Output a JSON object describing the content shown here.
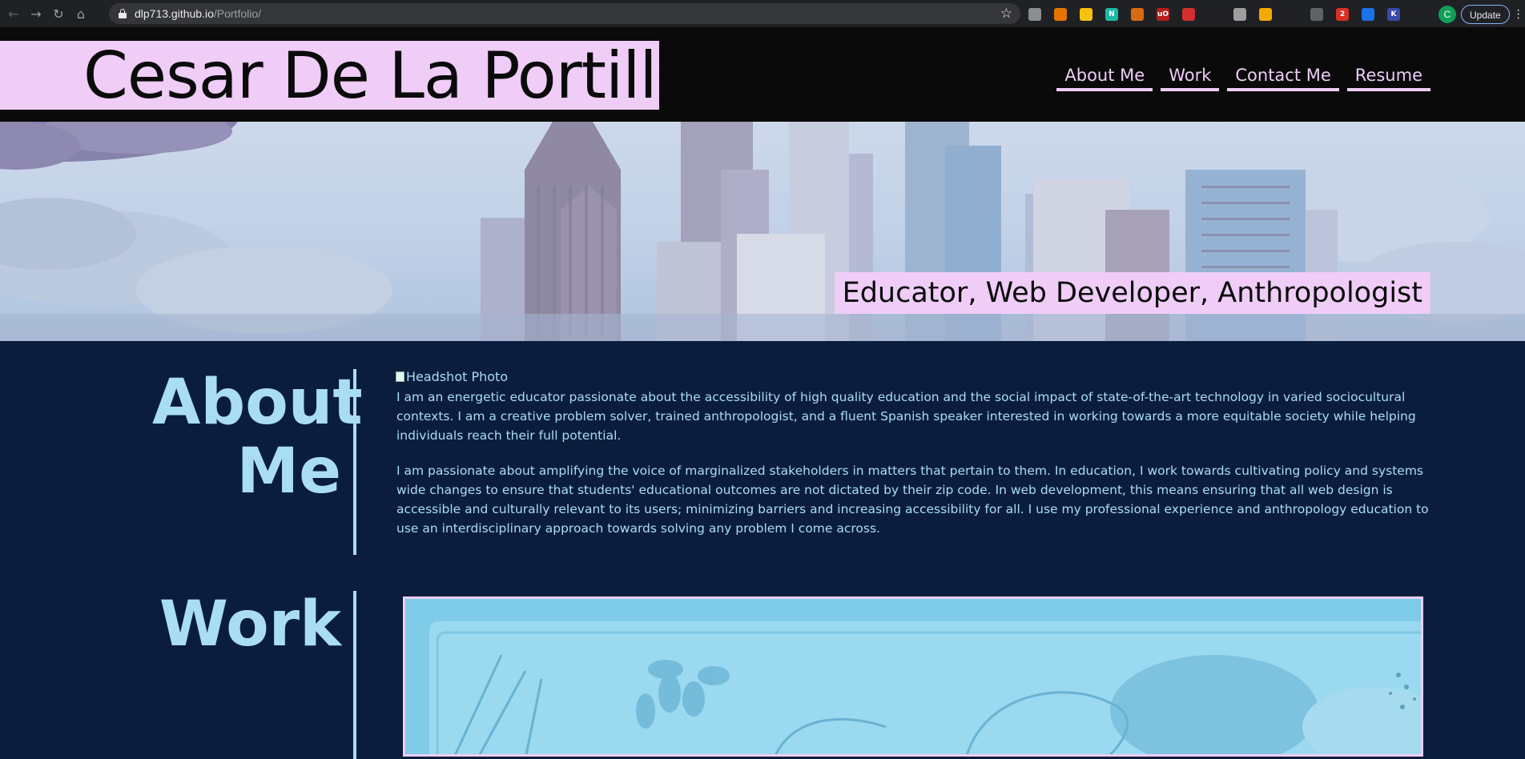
{
  "browser": {
    "url_host": "dlp713.github.io",
    "url_path": "/Portfolio/",
    "profile_initial": "C",
    "update_label": "Update",
    "extensions": [
      {
        "icon": "ext-icon-1",
        "color": "#8a8d91",
        "glyph": ""
      },
      {
        "icon": "ext-icon-2",
        "color": "#e37400",
        "glyph": ""
      },
      {
        "icon": "ext-icon-3",
        "color": "#f4c20d",
        "glyph": ""
      },
      {
        "icon": "ext-icon-4",
        "color": "#1db9a7",
        "glyph": "N"
      },
      {
        "icon": "ext-icon-5",
        "color": "#d86b12",
        "glyph": ""
      },
      {
        "icon": "ext-icon-6",
        "color": "#b71c1c",
        "glyph": "uO"
      },
      {
        "icon": "ext-icon-7",
        "color": "#d32f2f",
        "glyph": ""
      },
      {
        "icon": "ext-icon-8",
        "color": "#202124",
        "glyph": ""
      },
      {
        "icon": "ext-icon-9",
        "color": "#9e9e9e",
        "glyph": ""
      },
      {
        "icon": "ext-icon-10",
        "color": "#f2a900",
        "glyph": ""
      },
      {
        "icon": "ext-icon-11",
        "color": "#202124",
        "glyph": ""
      },
      {
        "icon": "ext-icon-12",
        "color": "#5f6368",
        "glyph": ""
      },
      {
        "icon": "ext-icon-13",
        "color": "#d93025",
        "glyph": "2"
      },
      {
        "icon": "ext-icon-14",
        "color": "#1a73e8",
        "glyph": ""
      },
      {
        "icon": "ext-icon-15",
        "color": "#3949ab",
        "glyph": "K"
      },
      {
        "icon": "ext-icon-16",
        "color": "#202124",
        "glyph": ""
      }
    ]
  },
  "header": {
    "name": "Cesar De La Portilla",
    "nav": [
      "About Me",
      "Work",
      "Contact Me",
      "Resume"
    ]
  },
  "hero": {
    "tagline": "Educator, Web Developer, Anthropologist"
  },
  "about": {
    "title_line1": "About",
    "title_line2": "Me",
    "headshot_alt": "Headshot Photo",
    "paragraph1": "I am an energetic educator passionate about the accessibility of high quality education and the social impact of state-of-the-art technology in varied sociocultural contexts. I am a creative problem solver, trained anthropologist, and a fluent Spanish speaker interested in working towards a more equitable society while helping individuals reach their full potential.",
    "paragraph2": "I am passionate about amplifying the voice of marginalized stakeholders in matters that pertain to them. In education, I work towards cultivating policy and systems wide changes to ensure that students' educational outcomes are not dictated by their zip code. In web development, this means ensuring that all web design is accessible and culturally relevant to its users; minimizing barriers and increasing accessibility for all. I use my professional experience and anthropology education to use an interdisciplinary approach towards solving any problem I come across."
  },
  "work": {
    "title": "Work"
  },
  "colors": {
    "accent_pink": "#efcdf7",
    "text_blue": "#a9ddf3",
    "page_bg": "#0b1d3d",
    "header_bg": "#0a0a0a"
  }
}
